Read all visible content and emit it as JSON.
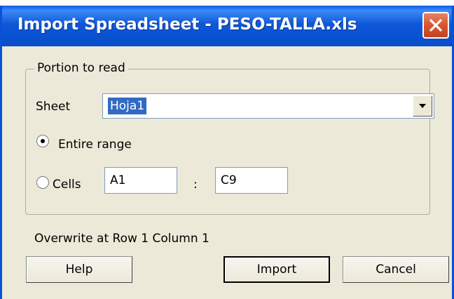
{
  "window": {
    "title": "Import Spreadsheet - PESO-TALLA.xls"
  },
  "portion_group": {
    "legend": "Portion to read",
    "sheet_label": "Sheet",
    "sheet_value": "Hoja1",
    "range_options": [
      {
        "label": "Entire range",
        "selected": true
      },
      {
        "label": "Cells",
        "selected": false
      }
    ],
    "cells_from": "A1",
    "cells_separator": ":",
    "cells_to": "C9"
  },
  "overwrite_text": "Overwrite at Row 1 Column 1",
  "buttons": {
    "help": "Help",
    "import": "Import",
    "cancel": "Cancel"
  },
  "colors": {
    "titlebar_blue": "#0a50d8",
    "dialog_bg": "#ece9d8",
    "selection": "#316ac5",
    "close_red": "#d9552f"
  },
  "icons": {
    "close": "close-icon",
    "dropdown": "chevron-down-icon"
  }
}
